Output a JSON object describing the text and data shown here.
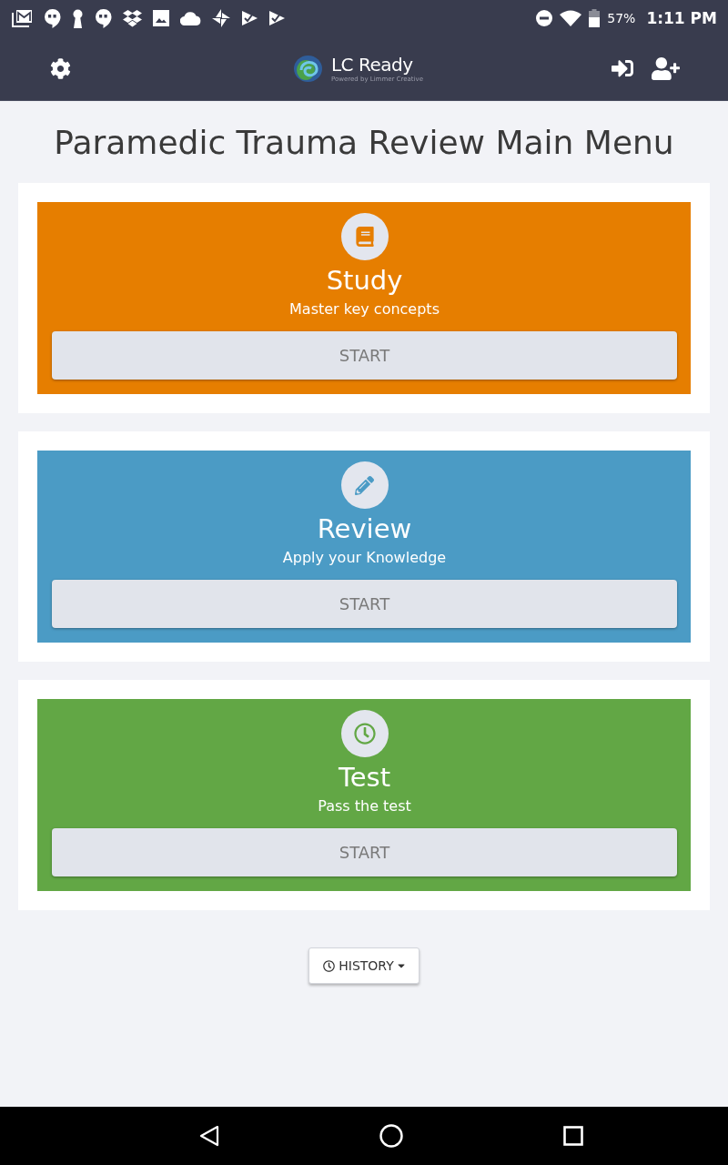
{
  "status_bar": {
    "battery": "57%",
    "time": "1:11 PM"
  },
  "header": {
    "logo": {
      "name": "LC Ready",
      "tagline": "Powered by Limmer Creative"
    }
  },
  "page_title": "Paramedic Trauma Review Main Menu",
  "modes": [
    {
      "kind": "study",
      "title": "Study",
      "subtitle": "Master key concepts",
      "color": "#e67e00",
      "button": "START"
    },
    {
      "kind": "review",
      "title": "Review",
      "subtitle": "Apply your Knowledge",
      "color": "#4b9bc5",
      "button": "START"
    },
    {
      "kind": "test",
      "title": "Test",
      "subtitle": "Pass the test",
      "color": "#62a745",
      "button": "START"
    }
  ],
  "history_button": {
    "label": "HISTORY"
  }
}
